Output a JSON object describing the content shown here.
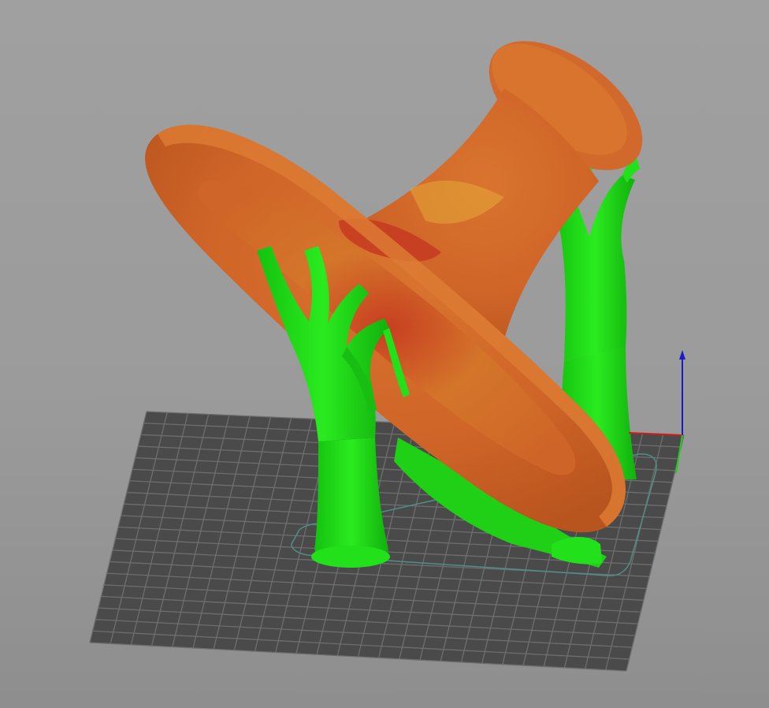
{
  "viewport": {
    "title": "",
    "background_top": "#a0a0a0",
    "background_bottom": "#8e8e8e"
  },
  "build_plate": {
    "color": "#4a4a4a",
    "grid_line_color": "#6e6e6e",
    "grid_columns": 26,
    "grid_rows": 20
  },
  "model": {
    "body_color": "#d2692c",
    "body_shade": "#b8541e",
    "overhang_color": "#c63a20",
    "highlight_color": "#e8b53a"
  },
  "supports": {
    "color": "#22e01a",
    "shade": "#14b510",
    "count": 3
  },
  "axes": {
    "x_color": "#d11a1a",
    "y_color": "#1fd11a",
    "z_color": "#1a1acc",
    "icon": "axis-gizmo-icon"
  },
  "skirt": {
    "color": "#4f8f86"
  }
}
